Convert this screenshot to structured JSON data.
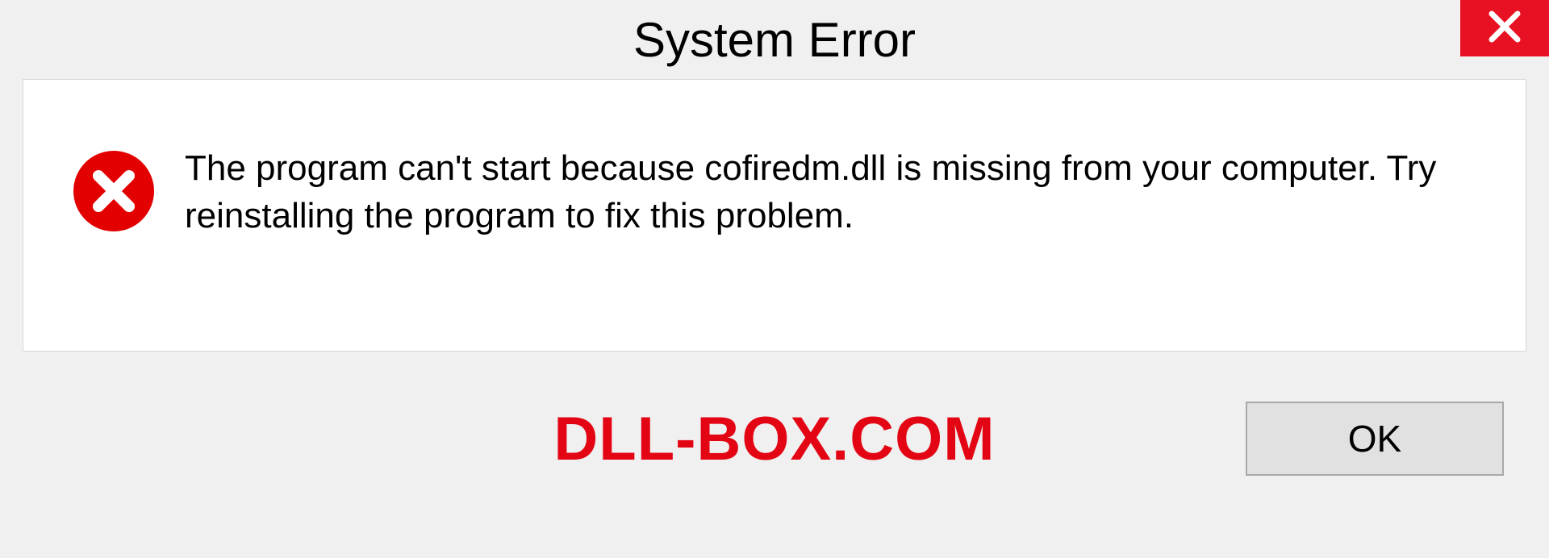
{
  "titlebar": {
    "title": "System Error"
  },
  "dialog": {
    "message": "The program can't start because cofiredm.dll is missing from your computer. Try reinstalling the program to fix this problem."
  },
  "footer": {
    "watermark": "DLL-BOX.COM",
    "ok_label": "OK"
  },
  "colors": {
    "close_bg": "#e81123",
    "error_icon": "#e30000",
    "watermark": "#e30513"
  }
}
